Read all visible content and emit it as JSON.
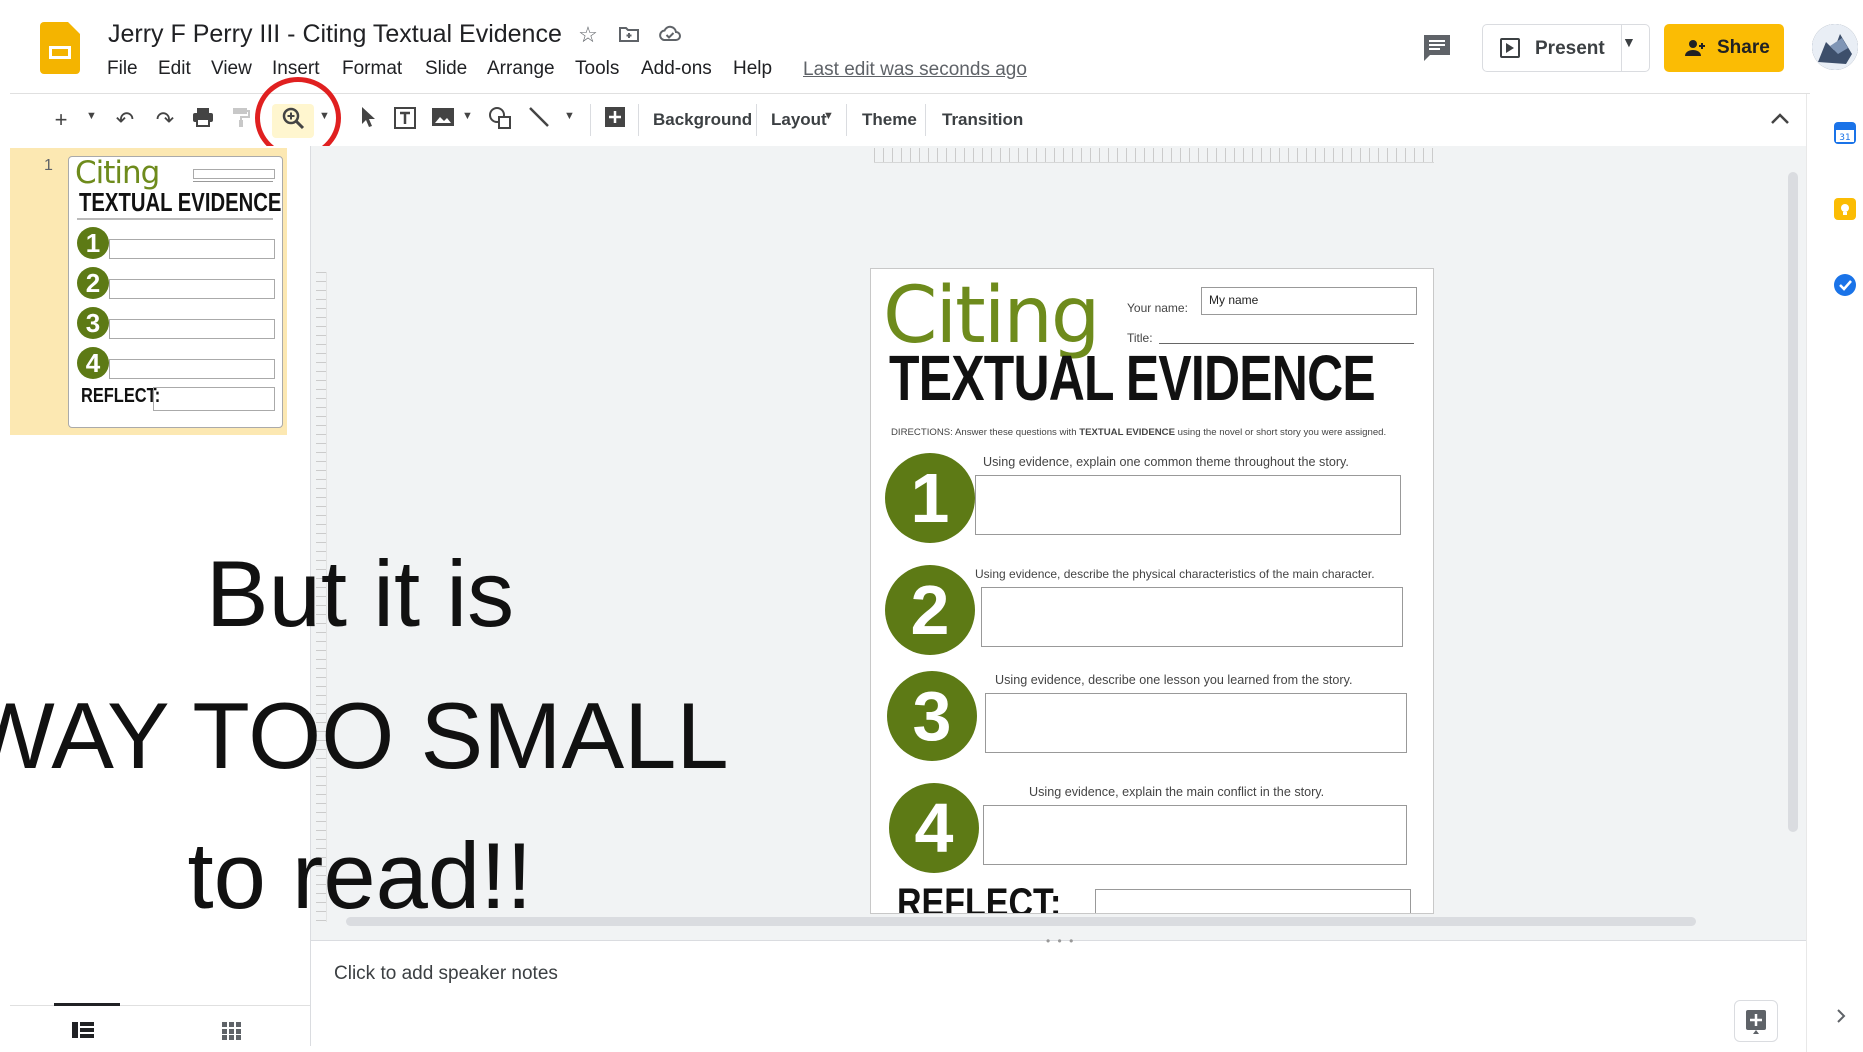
{
  "app": {
    "doc_title": "Jerry F Perry III - Citing Textual Evidence",
    "menu": [
      "File",
      "Edit",
      "View",
      "Insert",
      "Format",
      "Slide",
      "Arrange",
      "Tools",
      "Add-ons",
      "Help"
    ],
    "last_edit": "Last edit was seconds ago",
    "present_label": "Present",
    "share_label": "Share"
  },
  "toolbar": {
    "background_label": "Background",
    "layout_label": "Layout",
    "theme_label": "Theme",
    "transition_label": "Transition"
  },
  "filmstrip": {
    "slide_number": "1"
  },
  "slide": {
    "citing": "Citing",
    "heading": "TEXTUAL EVIDENCE",
    "your_name_label": "Your name:",
    "name_value": "My name",
    "title_label": "Title:",
    "directions_prefix": "DIRECTIONS: Answer these questions with ",
    "directions_bold": "TEXTUAL EVIDENCE",
    "directions_suffix": " using the novel or short story you were assigned.",
    "questions": [
      {
        "number": "1",
        "prompt": "Using evidence, explain one common theme throughout the story."
      },
      {
        "number": "2",
        "prompt": "Using evidence, describe the physical characteristics of the main character."
      },
      {
        "number": "3",
        "prompt": "Using evidence, describe one lesson you learned from the story."
      },
      {
        "number": "4",
        "prompt": "Using evidence, explain the main conflict in the story."
      }
    ],
    "reflect": "REFLECT:"
  },
  "notes": {
    "placeholder": "Click to add speaker notes"
  },
  "overlay": {
    "line1": "But it is",
    "line2": "WAY TOO SMALL",
    "line3": "to read!!"
  },
  "colors": {
    "share": "#fbbc04",
    "slides_logo": "#f4b400",
    "slide_green": "#5d7a15",
    "annotation_circle": "#e02020"
  }
}
